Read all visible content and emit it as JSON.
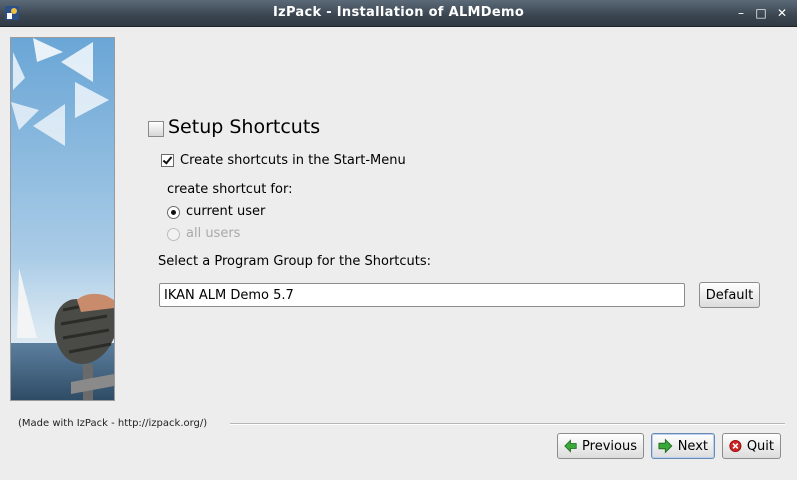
{
  "window": {
    "title": "IzPack - Installation of ALMDemo",
    "controls": {
      "minimize": "–",
      "maximize": "□",
      "close": "✕"
    }
  },
  "panel": {
    "heading": "Setup Shortcuts",
    "create_shortcuts_label": "Create shortcuts in the Start-Menu",
    "create_shortcuts_checked": true,
    "create_for_label": "create shortcut for:",
    "radio_current_user": "current user",
    "radio_all_users": "all users",
    "selected_radio": "current user",
    "program_group_label": "Select a Program Group for the Shortcuts:",
    "program_group_value": "IKAN ALM Demo 5.7",
    "default_button": "Default"
  },
  "footer": {
    "made_with": "(Made with IzPack - http://izpack.org/)",
    "previous": "Previous",
    "next": "Next",
    "quit": "Quit"
  },
  "icons": {
    "previous": "arrow-left-icon",
    "next": "arrow-right-icon",
    "quit": "cancel-icon"
  },
  "colors": {
    "titlebar": "#3a4550",
    "background": "#ededed",
    "arrow_green": "#3aa83a",
    "quit_red": "#d02020"
  }
}
